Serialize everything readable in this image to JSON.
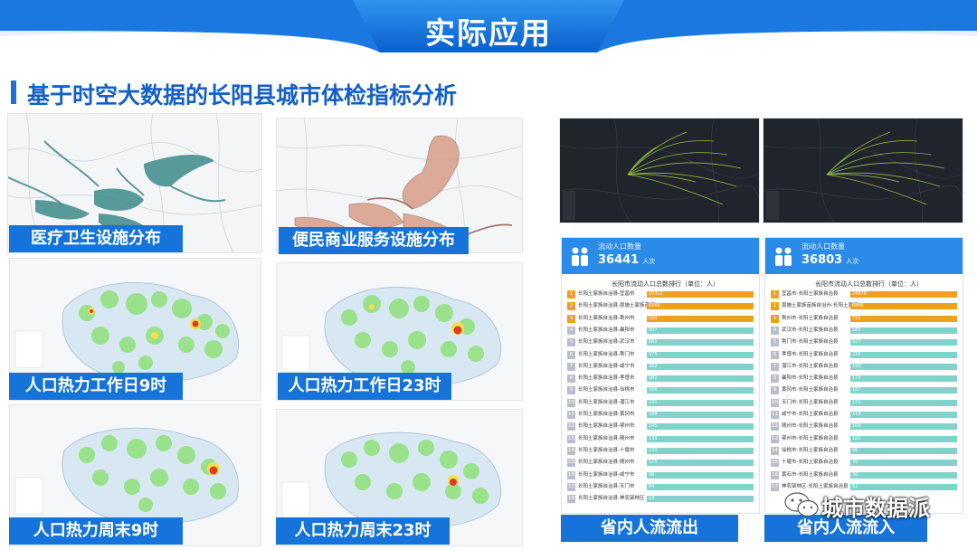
{
  "header": {
    "title": "实际应用"
  },
  "section": {
    "title": "基于时空大数据的长阳县城市体检指标分析"
  },
  "panels": {
    "medical": "医疗卫生设施分布",
    "commerce": "便民商业服务设施分布",
    "workday9": "人口热力工作日9时",
    "workday23": "人口热力工作日23时",
    "weekend9": "人口热力周末9时",
    "weekend23": "人口热力周末23时",
    "outflow": "省内人流流出",
    "inflow": "省内人流流入"
  },
  "outflow_stats": {
    "label": "流动人口数量",
    "value": "36441",
    "unit": "人次",
    "rank_title": "长阳市流动人口总数排行（单位：人）",
    "rows": [
      {
        "n": "1",
        "name": "长阳土家族自治县-宜昌市",
        "v": "20312"
      },
      {
        "n": "2",
        "name": "长阳土家族自治县-恩施土家族苗族...",
        "v": "6566"
      },
      {
        "n": "3",
        "name": "长阳土家族自治县-荆州市",
        "v": "564"
      },
      {
        "n": "4",
        "name": "长阳土家族自治县-襄阳市",
        "v": "907"
      },
      {
        "n": "5",
        "name": "长阳土家族自治县-武汉市",
        "v": "881"
      },
      {
        "n": "6",
        "name": "长阳土家族自治县-荆门市",
        "v": "575"
      },
      {
        "n": "7",
        "name": "长阳土家族自治县-咸宁市",
        "v": "382"
      },
      {
        "n": "8",
        "name": "长阳土家族自治县-孝感市",
        "v": "282"
      },
      {
        "n": "9",
        "name": "长阳土家族自治县-仙桃市",
        "v": "266"
      },
      {
        "n": "10",
        "name": "长阳土家族自治县-潜江市",
        "v": "231"
      },
      {
        "n": "11",
        "name": "长阳土家族自治县-黄冈市",
        "v": "188"
      },
      {
        "n": "12",
        "name": "长阳土家族自治县-鄂州市",
        "v": "145"
      },
      {
        "n": "13",
        "name": "长阳土家族自治县-随州市",
        "v": "133"
      },
      {
        "n": "14",
        "name": "长阳土家族自治县-十堰市",
        "v": "130"
      },
      {
        "n": "15",
        "name": "长阳土家族自治县-随州市",
        "v": "125"
      },
      {
        "n": "16",
        "name": "长阳土家族自治县-咸宁市",
        "v": "98"
      },
      {
        "n": "17",
        "name": "长阳土家族自治县-天门市",
        "v": "84"
      },
      {
        "n": "18",
        "name": "长阳土家族自治县-神农架林区",
        "v": "13"
      }
    ]
  },
  "inflow_stats": {
    "label": "流动人口数量",
    "value": "36803",
    "unit": "人次",
    "rank_title": "长阳市流动人口总数排行（单位：人）",
    "rows": [
      {
        "n": "1",
        "name": "宜昌市-长阳土家族自治县",
        "v": "24078"
      },
      {
        "n": "2",
        "name": "恩施土家族苗族自治州-长阳土家族...",
        "v": "6846"
      },
      {
        "n": "3",
        "name": "荆州市-长阳土家族自治县",
        "v": "721"
      },
      {
        "n": "4",
        "name": "武汉市-长阳土家族自治县",
        "v": "585"
      },
      {
        "n": "5",
        "name": "荆门市-长阳土家族自治县",
        "v": "527"
      },
      {
        "n": "6",
        "name": "孝感市-长阳土家族自治县",
        "v": "222"
      },
      {
        "n": "7",
        "name": "潜江市-长阳土家族自治县",
        "v": "193"
      },
      {
        "n": "8",
        "name": "襄阳市-长阳土家族自治县",
        "v": "173"
      },
      {
        "n": "9",
        "name": "黄冈市-长阳土家族自治县",
        "v": "167"
      },
      {
        "n": "10",
        "name": "天门市-长阳土家族自治县",
        "v": "151"
      },
      {
        "n": "11",
        "name": "咸宁市-长阳土家族自治县",
        "v": "114"
      },
      {
        "n": "12",
        "name": "随州市-长阳土家族自治县",
        "v": "108"
      },
      {
        "n": "13",
        "name": "鄂州市-长阳土家族自治县",
        "v": "101"
      },
      {
        "n": "14",
        "name": "仙桃市-长阳土家族自治县",
        "v": "96"
      },
      {
        "n": "15",
        "name": "十堰市-长阳土家族自治县",
        "v": "70"
      },
      {
        "n": "16",
        "name": "黄石市-长阳土家族自治县",
        "v": "30"
      },
      {
        "n": "17",
        "name": "神农架林区-长阳土家族自治县",
        "v": "12"
      }
    ]
  },
  "watermark": {
    "text": "城市数据派"
  },
  "colors": {
    "brand_blue": "#1573d9",
    "top_rank": "#f0a01e",
    "bar": "#7fd3c9",
    "title_blue": "#1560c8"
  }
}
